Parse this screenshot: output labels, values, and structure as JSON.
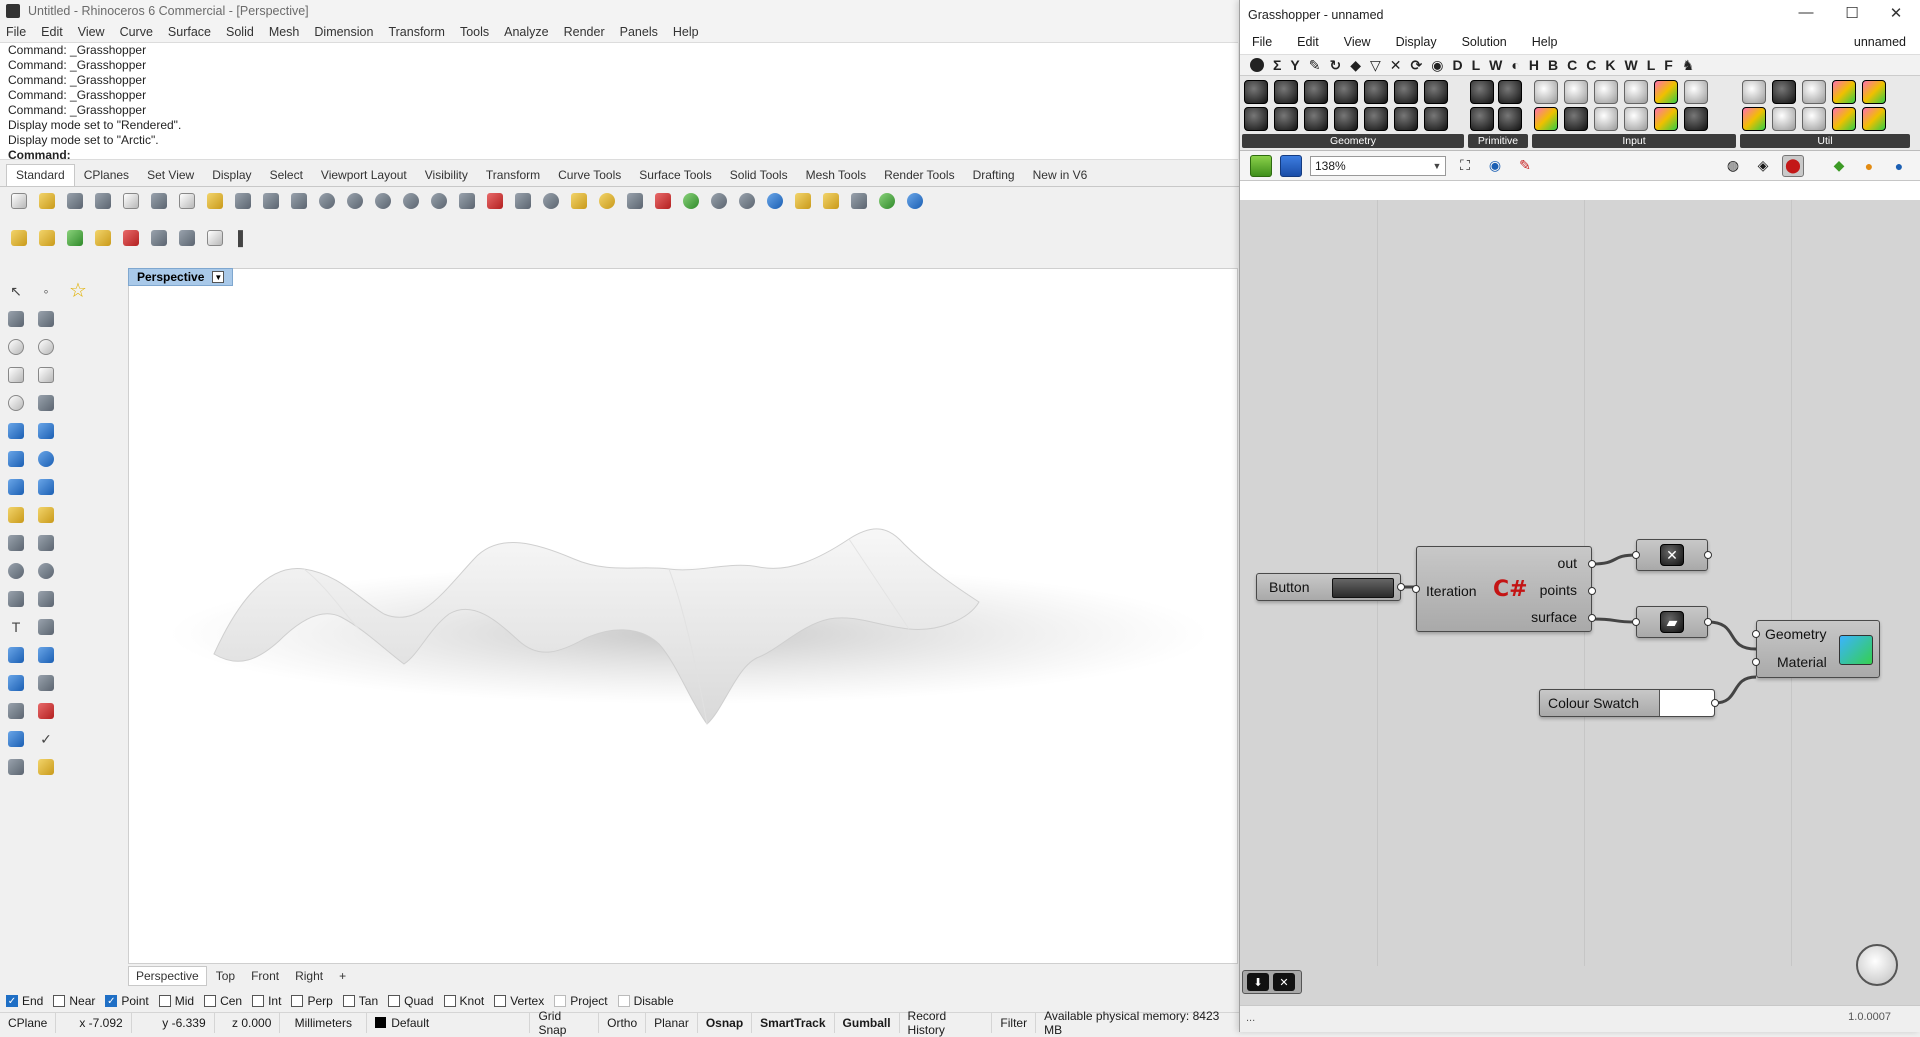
{
  "rhino": {
    "title": "Untitled - Rhinoceros 6 Commercial - [Perspective]",
    "menu": [
      "File",
      "Edit",
      "View",
      "Curve",
      "Surface",
      "Solid",
      "Mesh",
      "Dimension",
      "Transform",
      "Tools",
      "Analyze",
      "Render",
      "Panels",
      "Help"
    ],
    "history": [
      "Command: _Grasshopper",
      "Command: _Grasshopper",
      "Command: _Grasshopper",
      "Command: _Grasshopper",
      "Command: _Grasshopper",
      "Display mode set to \"Rendered\".",
      "Display mode set to \"Arctic\"."
    ],
    "prompt": "Command:",
    "toolbar_tabs": [
      "Standard",
      "CPlanes",
      "Set View",
      "Display",
      "Select",
      "Viewport Layout",
      "Visibility",
      "Transform",
      "Curve Tools",
      "Surface Tools",
      "Solid Tools",
      "Mesh Tools",
      "Render Tools",
      "Drafting",
      "New in V6"
    ],
    "viewport_label": "Perspective",
    "viewport_tabs": [
      "Perspective",
      "Top",
      "Front",
      "Right",
      "+"
    ],
    "osnaps": [
      {
        "label": "End",
        "checked": true
      },
      {
        "label": "Near",
        "checked": false
      },
      {
        "label": "Point",
        "checked": true
      },
      {
        "label": "Mid",
        "checked": false
      },
      {
        "label": "Cen",
        "checked": false
      },
      {
        "label": "Int",
        "checked": false
      },
      {
        "label": "Perp",
        "checked": false
      },
      {
        "label": "Tan",
        "checked": false
      },
      {
        "label": "Quad",
        "checked": false
      },
      {
        "label": "Knot",
        "checked": false
      },
      {
        "label": "Vertex",
        "checked": false
      },
      {
        "label": "Project",
        "checked": false
      },
      {
        "label": "Disable",
        "checked": false
      }
    ],
    "status": {
      "cplane": "CPlane",
      "x": "x -7.092",
      "y": "y -6.339",
      "z": "z 0.000",
      "units": "Millimeters",
      "layer": "Default",
      "grid_snap": "Grid Snap",
      "ortho": "Ortho",
      "planar": "Planar",
      "osnap": "Osnap",
      "smarttrack": "SmartTrack",
      "gumball": "Gumball",
      "record_history": "Record History",
      "filter": "Filter",
      "memory": "Available physical memory: 8423 MB"
    }
  },
  "gh": {
    "title": "Grasshopper - unnamed",
    "menu": [
      "File",
      "Edit",
      "View",
      "Display",
      "Solution",
      "Help"
    ],
    "doc_name": "unnamed",
    "category_tabs": [
      "Σ",
      "Y",
      "✎",
      "↻",
      "◆",
      "▽",
      "✕",
      "⟳",
      "◉",
      "D",
      "L",
      "W",
      "◐",
      "H",
      "B",
      "C",
      "C",
      "K",
      "W",
      "L",
      "F",
      "♞",
      "W"
    ],
    "ribbon_groups": [
      "Geometry",
      "Primitive",
      "Input",
      "Util"
    ],
    "zoom": "138%",
    "nodes": {
      "button": "Button",
      "script_input": "Iteration",
      "script_outputs": [
        "out",
        "points",
        "surface"
      ],
      "colour_swatch": "Colour Swatch",
      "preview_inputs": [
        "Geometry",
        "Material"
      ]
    },
    "status_left": "...",
    "version": "1.0.0007"
  }
}
